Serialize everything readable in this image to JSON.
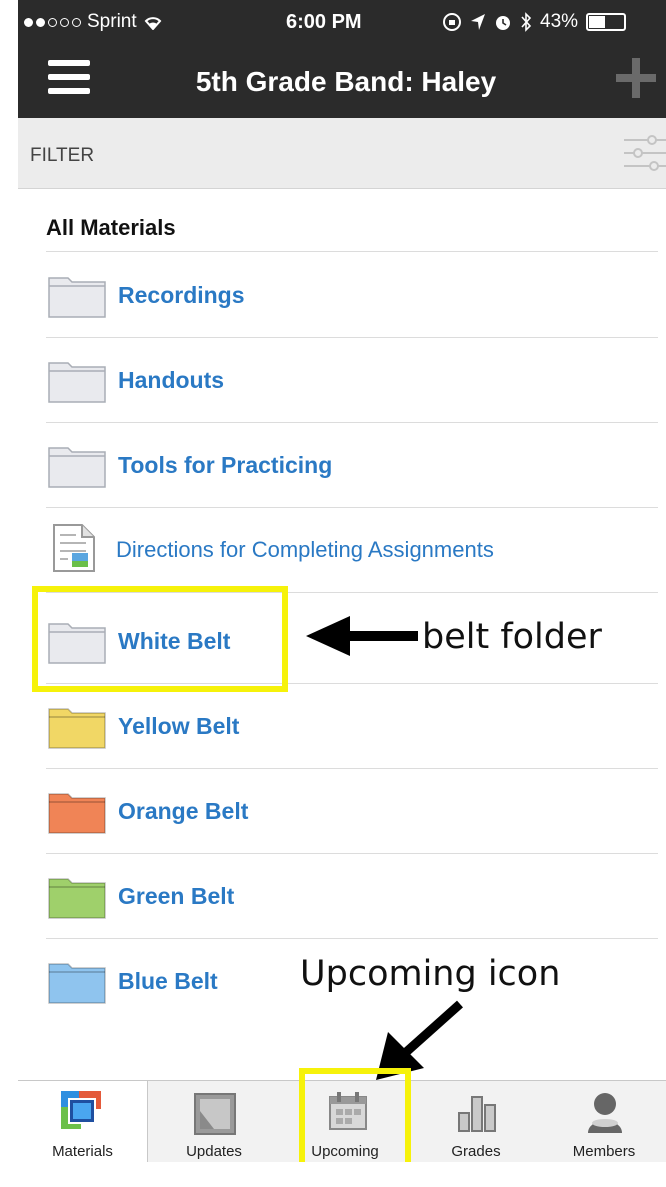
{
  "status_bar": {
    "carrier": "Sprint",
    "time": "6:00 PM",
    "battery": "43%"
  },
  "header": {
    "title": "5th Grade Band: Haley"
  },
  "filter": {
    "label": "FILTER"
  },
  "section": {
    "title": "All Materials"
  },
  "items": [
    {
      "label": "Recordings",
      "kind": "folder",
      "color": "#e9eaee"
    },
    {
      "label": "Handouts",
      "kind": "folder",
      "color": "#e9eaee"
    },
    {
      "label": "Tools for Practicing",
      "kind": "folder",
      "color": "#e9eaee"
    },
    {
      "label": "Directions for Completing Assignments",
      "kind": "document",
      "color": "#ffffff"
    },
    {
      "label": "White Belt",
      "kind": "folder",
      "color": "#e9eaee"
    },
    {
      "label": "Yellow Belt",
      "kind": "folder",
      "color": "#f1d765"
    },
    {
      "label": "Orange Belt",
      "kind": "folder",
      "color": "#f08456"
    },
    {
      "label": "Green Belt",
      "kind": "folder",
      "color": "#9fd06b"
    },
    {
      "label": "Blue Belt",
      "kind": "folder",
      "color": "#8fc4ee"
    }
  ],
  "annotations": {
    "belt_folder": "belt folder",
    "upcoming_icon": "Upcoming icon"
  },
  "tabs": [
    {
      "label": "Materials",
      "icon": "materials-icon"
    },
    {
      "label": "Updates",
      "icon": "updates-icon"
    },
    {
      "label": "Upcoming",
      "icon": "calendar-icon"
    },
    {
      "label": "Grades",
      "icon": "grades-icon"
    },
    {
      "label": "Members",
      "icon": "member-icon"
    }
  ],
  "colors": {
    "header_bg": "#2b2b2b",
    "link_blue": "#2a79c4",
    "highlight_yellow": "#f6f20a"
  }
}
